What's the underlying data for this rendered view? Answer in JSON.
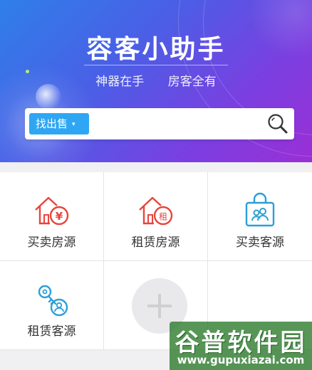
{
  "header": {
    "title": "容客小助手",
    "slogan_left": "神器在手",
    "slogan_right": "房客全有"
  },
  "search": {
    "type_label": "找出售",
    "caret": "▾",
    "placeholder": "",
    "icon": "search-icon"
  },
  "menu": {
    "items": [
      {
        "label": "买卖房源",
        "icon": "house-yuan-icon",
        "color": "#e8453c"
      },
      {
        "label": "租赁房源",
        "icon": "house-rent-icon",
        "color": "#e8453c"
      },
      {
        "label": "买卖客源",
        "icon": "shopping-bag-clients-icon",
        "color": "#2a9fd8"
      },
      {
        "label": "租赁客源",
        "icon": "key-person-icon",
        "color": "#2a9fd8"
      }
    ],
    "add_icon": "plus-icon",
    "rent_glyph": "租",
    "yuan_glyph": "¥"
  },
  "watermark": {
    "title": "谷普软件园",
    "url": "www.gupuxiazai.com"
  }
}
